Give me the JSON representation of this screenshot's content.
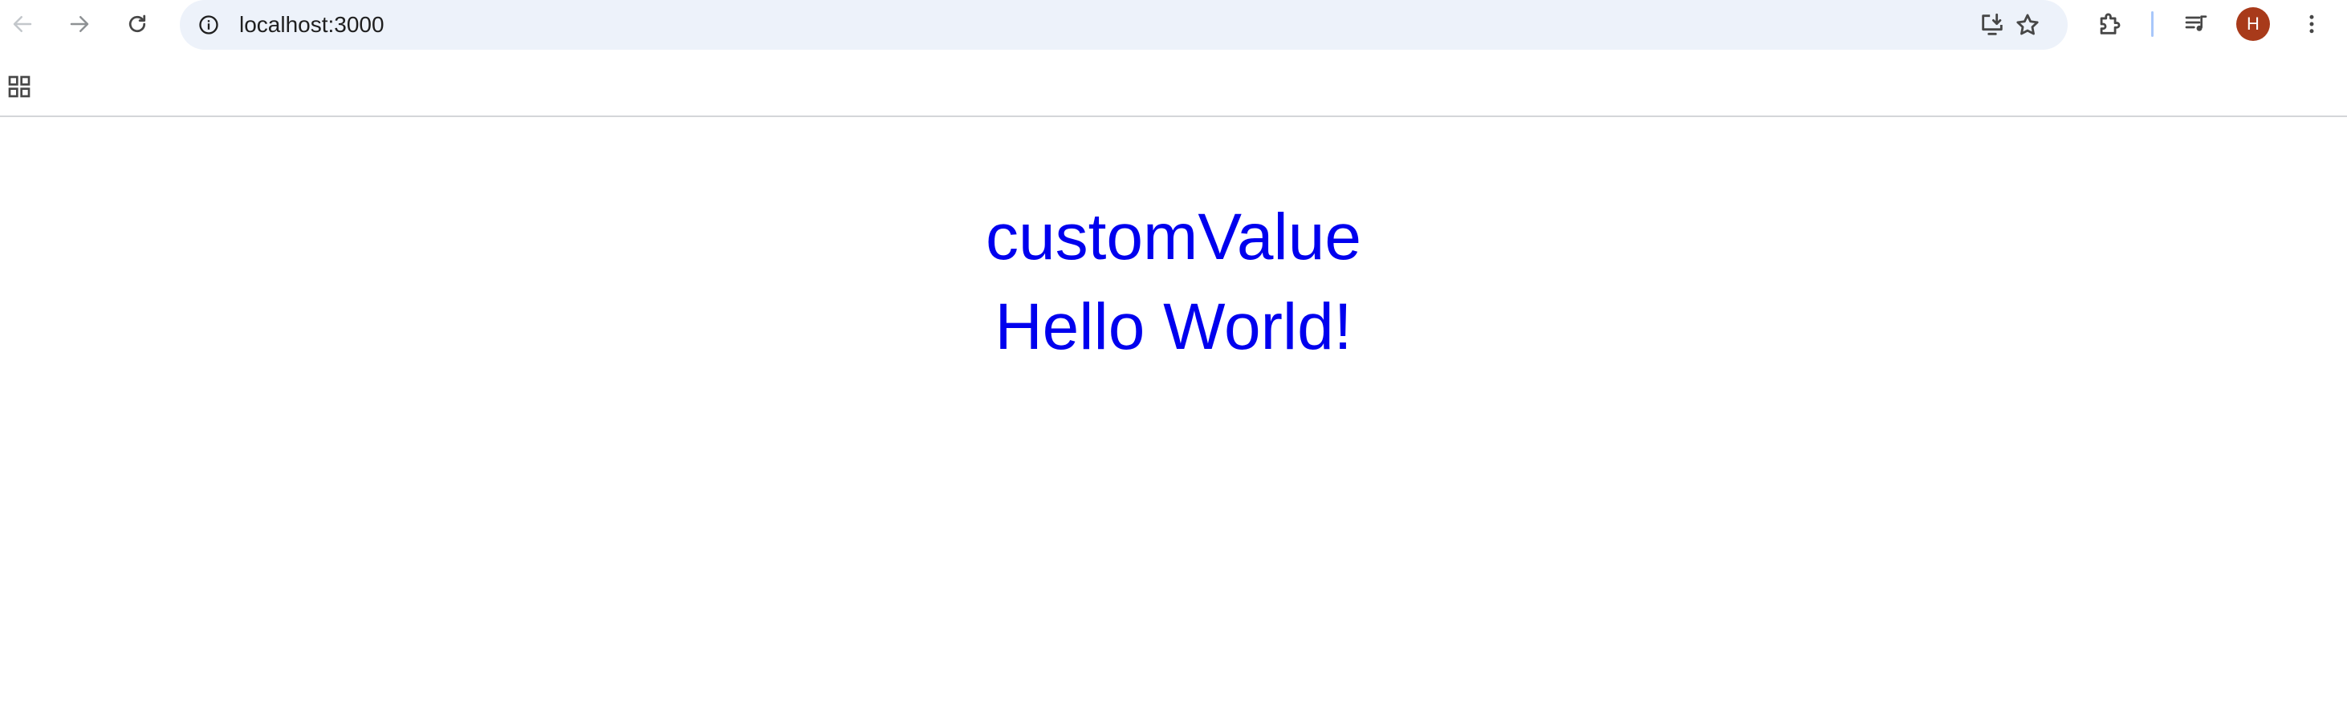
{
  "browser": {
    "url": "localhost:3000",
    "profile_initial": "H",
    "icons": {
      "back": "arrow-left-icon",
      "forward": "arrow-right-icon",
      "reload": "reload-icon",
      "site_info": "info-icon",
      "install": "install-app-icon",
      "bookmark": "star-icon",
      "extensions": "puzzle-icon",
      "media": "media-queue-icon",
      "menu": "three-dots-icon",
      "apps": "apps-grid-icon"
    },
    "colors": {
      "omnibox_bg": "#edf2fa",
      "avatar_bg": "#a83a1a",
      "divider": "#a8c7fa"
    }
  },
  "page": {
    "lines": [
      "customValue",
      "Hello World!"
    ],
    "text_color": "#0000ee"
  }
}
